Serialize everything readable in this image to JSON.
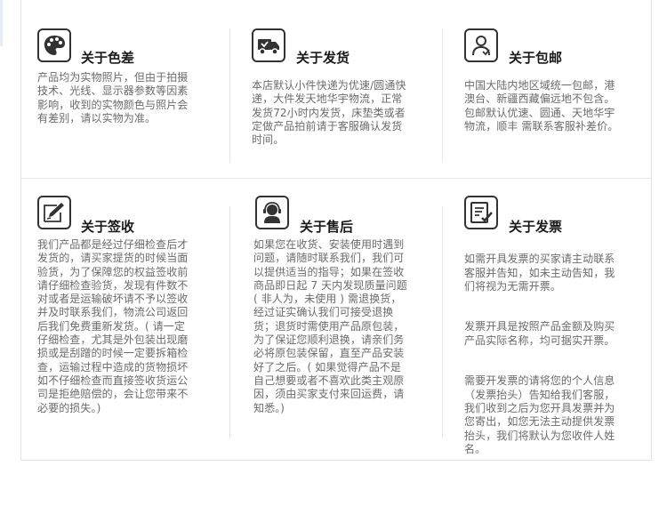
{
  "sections": [
    {
      "id": "color",
      "icon": "palette-icon",
      "title": "关于色差",
      "text": "产品均为实物照片，但由于拍摄\n技术、光线、显示器参数等因素\n影响，收到的实物颜色与照片会\n有差别，请以实物为准。"
    },
    {
      "id": "shipping",
      "icon": "delivery-truck-icon",
      "title": "关于发货",
      "text": "本店默认小件快递为优速/圆通快\n递，大件发天地华宇物流，正常\n发货72小时内发货，床垫类或者\n定做产品拍前请于客服确认发货\n时间。"
    },
    {
      "id": "postage",
      "icon": "customer-service-person-icon",
      "title": "关于包邮",
      "text": "中国大陆内地区域统一包邮，港\n澳台、新疆西藏偏远地不包含。\n包邮默认优速、圆通、天地华宇\n物流，顺丰 需联系客服补差价。"
    },
    {
      "id": "signing",
      "icon": "sign-pen-icon",
      "title": "关于签收",
      "text": "我们产品都是经过仔细检查后才\n发货的，请买家提货的时候当面\n验货，为了保障您的权益签收前\n请仔细检查验货，发现有件数不\n对或者是运输破坏请不予以签收\n并及时联系我们，物流公司返回\n后我们免费重新发货。( 请一定\n仔细检查，尤其是外包装出现磨\n损或是刮蹭的时候一定要拆箱检\n查，运输过程中造成的货物损坏\n如不仔细检查而直接签收货运公\n司是拒绝赔偿的，会让您带来不\n必要的损失。)"
    },
    {
      "id": "aftersale",
      "icon": "headset-agent-icon",
      "title": "关于售后",
      "text": "如果您在收货、安装使用时遇到\n问题，请随时联系我们，我们可\n以提供适当的指导；如果在签收\n商品即日起 7 天内发现质量问题\n( 非人为，未使用 ) 需退换货，\n经过证实确认我们可接受退换\n货；退货时需使用产品原包装，\n为了保证您顺利退换，请亲们务\n必将原包装保留，直至产品安装\n好了之后。( 如果觉得产品不是\n自己想要或者不喜欢此类主观原\n因，须由买家支付来回运费，请\n知悉。)"
    },
    {
      "id": "invoice",
      "icon": "invoice-check-icon",
      "title": "关于发票",
      "paragraphs": [
        "如需开具发票的买家请主动联系\n客服并告知，如未主动告知，我\n们将视为无需开票。",
        "发票开具是按照产品金额及购买\n产品实际名称，均可据实开票。",
        "需要开发票的请将您的个人信息\n（发票抬头）告知给我们客服，\n我们收到之后为您开具发票并为\n您寄出，如您无法主动提供发票\n抬头，我们将默认为您收件人姓\n名。"
      ]
    }
  ]
}
